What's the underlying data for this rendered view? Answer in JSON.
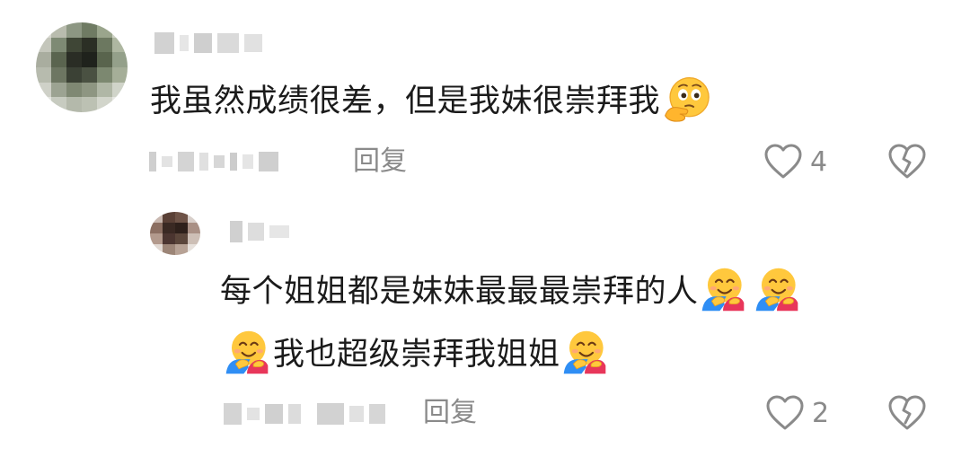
{
  "comment": {
    "text": "我虽然成绩很差，但是我妹很崇拜我",
    "emoji_icon": "thinking-face-emoji",
    "reply_label": "回复",
    "like_count": "4"
  },
  "reply": {
    "line1": "每个姐姐都是妹妹最最最崇拜的人",
    "line2": "我也超级崇拜我姐姐",
    "emoji_icon": "hugging-face-emoji",
    "reply_label": "回复",
    "like_count": "2"
  },
  "icons": {
    "like": "heart-outline-icon",
    "dislike": "broken-heart-icon"
  },
  "colors": {
    "text": "#1b1b1b",
    "muted": "#8a8a8a",
    "icon": "#8a8a8a"
  }
}
